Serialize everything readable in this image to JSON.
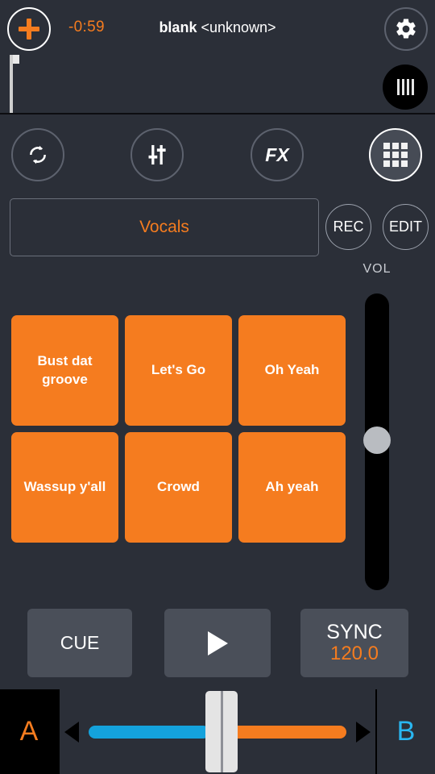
{
  "header": {
    "add_icon": "plus-icon",
    "time_remaining": "-0:59",
    "track_name": "blank",
    "track_artist": "<unknown>",
    "settings_icon": "gear-icon",
    "vinyl_icon": "vinyl-bars-icon",
    "accent_color": "#f57c1f"
  },
  "toolbar": {
    "items": [
      {
        "name": "loop-button",
        "icon": "loop-repeat-icon",
        "label": "",
        "active": false
      },
      {
        "name": "mixer-button",
        "icon": "sliders-icon",
        "label": "",
        "active": false
      },
      {
        "name": "fx-button",
        "icon": "fx-icon",
        "label": "FX",
        "active": false
      },
      {
        "name": "pads-button",
        "icon": "grid-icon",
        "label": "",
        "active": true
      }
    ]
  },
  "bank": {
    "name": "Vocals",
    "rec_label": "REC",
    "edit_label": "EDIT",
    "vol_label": "VOL"
  },
  "pads": [
    "Bust dat groove",
    "Let's Go",
    "Oh Yeah",
    "Wassup y'all",
    "Crowd",
    "Ah yeah"
  ],
  "transport": {
    "cue_label": "CUE",
    "play_icon": "play-triangle-icon",
    "sync_label": "SYNC",
    "bpm": "120.0"
  },
  "crossfader": {
    "deck_a_label": "A",
    "deck_b_label": "B",
    "left_color": "#14a2dc",
    "right_color": "#f57c1f",
    "arrow_left_icon": "arrow-left-icon",
    "arrow_right_icon": "arrow-right-icon"
  },
  "volume": {
    "level_label": "VOL"
  }
}
